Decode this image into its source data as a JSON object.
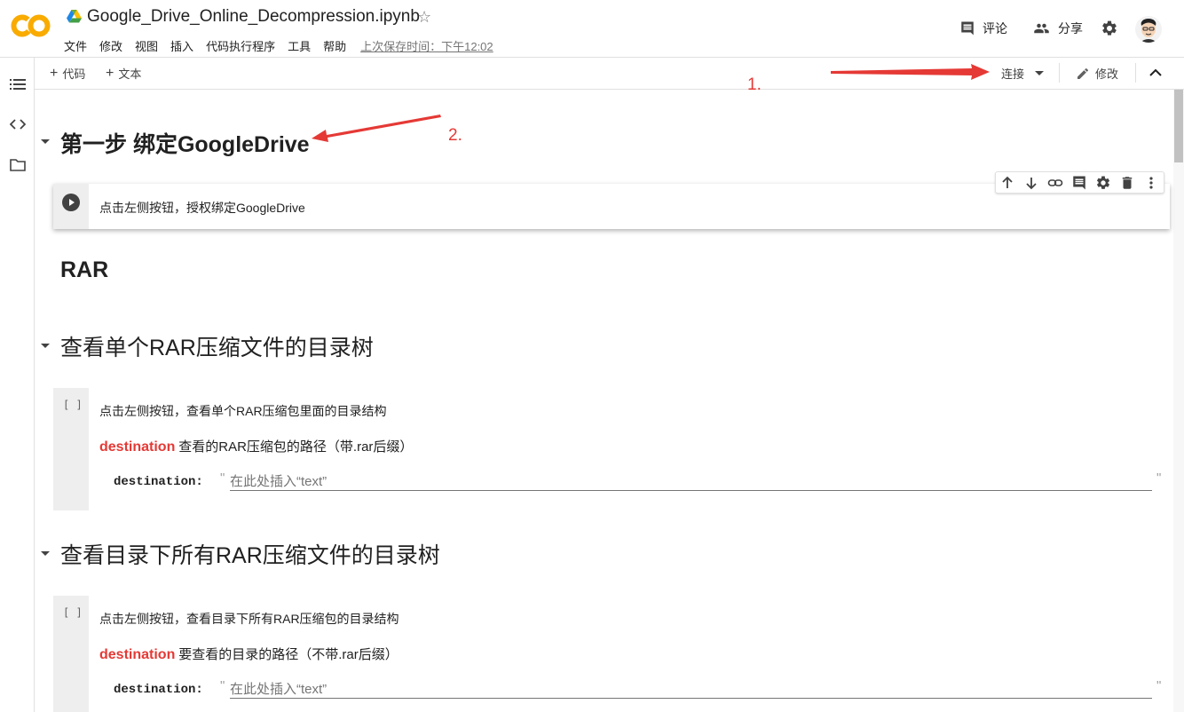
{
  "header": {
    "title": "Google_Drive_Online_Decompression.ipynb",
    "logo_text": "CO",
    "menu": [
      "文件",
      "修改",
      "视图",
      "插入",
      "代码执行程序",
      "工具",
      "帮助"
    ],
    "last_saved": "上次保存时间：下午12:02",
    "comment_label": "评论",
    "share_label": "分享"
  },
  "toolbar": {
    "add_code": "代码",
    "add_text": "文本",
    "connect": "连接",
    "edit": "修改"
  },
  "notebook": {
    "section1_title": "第一步 绑定GoogleDrive",
    "cell1_text": "点击左侧按钮，授权绑定GoogleDrive",
    "rar_heading": "RAR",
    "section2_title": "查看单个RAR压缩文件的目录树",
    "cell2": {
      "bracket": "[ ]",
      "desc": "点击左侧按钮，查看单个RAR压缩包里面的目录结构",
      "dest_key": "destination",
      "dest_desc": "查看的RAR压缩包的路径（带.rar后缀）",
      "param_label": "destination:",
      "param_placeholder": "在此处插入“text”"
    },
    "section3_title": "查看目录下所有RAR压缩文件的目录树",
    "cell3": {
      "bracket": "[ ]",
      "desc": "点击左侧按钮，查看目录下所有RAR压缩包的目录结构",
      "dest_key": "destination",
      "dest_desc": "要查看的目录的路径（不带.rar后缀）",
      "param_label": "destination:",
      "param_placeholder": "在此处插入“text”"
    }
  },
  "annotations": {
    "a1": "1.",
    "a2": "2."
  },
  "colors": {
    "accent_orange": "#F9AB00",
    "annotation_red": "#E53935",
    "destination_red": "#E53935"
  },
  "icons": [
    "drive-icon",
    "star-icon",
    "comment-icon",
    "share-icon",
    "gear-icon",
    "avatar",
    "toc-icon",
    "code-snippets-icon",
    "files-icon",
    "dropdown-icon",
    "pencil-icon",
    "collapse-icon",
    "run-icon",
    "move-up-icon",
    "move-down-icon",
    "link-icon",
    "comment-cell-icon",
    "settings-cell-icon",
    "delete-icon",
    "more-vert-icon",
    "collapse-section-icon"
  ]
}
